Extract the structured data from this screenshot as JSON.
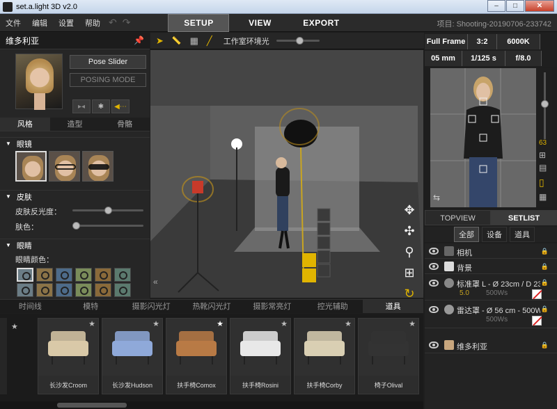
{
  "window": {
    "title": "set.a.light 3D v2.0",
    "min": "–",
    "max": "□",
    "close": "✕"
  },
  "menu": {
    "items": [
      "文件",
      "编辑",
      "设置",
      "帮助"
    ],
    "undo": "↶",
    "redo": "↷",
    "tabs": [
      "SETUP",
      "VIEW",
      "EXPORT"
    ],
    "active_tab": "SETUP",
    "project": "项目: Shooting-20190706-233742"
  },
  "left": {
    "model_name": "维多利亚",
    "pose_slider": "Pose Slider",
    "posing_mode": "POSING MODE",
    "subtabs": [
      "风格",
      "造型",
      "骨骼"
    ],
    "active_subtab": "风格",
    "glasses_label": "眼镜",
    "skin_label": "皮肤",
    "skin_reflect": "皮肤反光度：",
    "skin_color": "肤色：",
    "eyes_label": "眼睛",
    "eye_color": "眼睛颜色：",
    "eye_colors": [
      "#6b7d86",
      "#8b7347",
      "#4d6b8a",
      "#7a8c5a",
      "#8a6a3a",
      "#5b7a6e"
    ],
    "skin_reflect_value": 0.5,
    "skin_color_value": 0.0
  },
  "viewport": {
    "ambient_label": "工作室环境光",
    "nav": [
      "✥",
      "✣",
      "⚲",
      "⊞",
      "↻"
    ],
    "collapse": "«"
  },
  "bottom": {
    "categories": [
      "时间线",
      "模特",
      "摄影闪光灯",
      "热靴闪光灯",
      "摄影常亮灯",
      "控光辅助",
      "道具"
    ],
    "active_category": "道具",
    "items": [
      {
        "label": "长沙发Croom",
        "color": "#d9c9a8",
        "starred": false
      },
      {
        "label": "长沙发Hudson",
        "color": "#8fa9d9",
        "starred": false
      },
      {
        "label": "扶手椅Comox",
        "color": "#b87a45",
        "starred": true
      },
      {
        "label": "扶手椅Rosini",
        "color": "#e8e8e8",
        "starred": false
      },
      {
        "label": "扶手椅Corby",
        "color": "#d9cfb3",
        "starred": false
      },
      {
        "label": "椅子Olival",
        "color": "#333333",
        "starred": false
      }
    ],
    "star": "★"
  },
  "right": {
    "camera": {
      "format": "Full Frame",
      "ratio": "3:2",
      "wb": "6000K",
      "focal": "05 mm",
      "shutter": "1/125 s",
      "aperture": "f/8.0",
      "zoom_value": "63"
    },
    "tabs": [
      "TOPVIEW",
      "SETLIST"
    ],
    "active_tab": "SETLIST",
    "subtabs": [
      "全部",
      "设备",
      "道具"
    ],
    "active_subtab": "全部",
    "list": [
      {
        "name": "相机"
      },
      {
        "name": "背景"
      },
      {
        "name": "标准罩 L - Ø 23cm / D 23",
        "power": "5.0",
        "watt": "500Ws"
      },
      {
        "name": "雷达罩 - Ø 56 cm - 500W",
        "power": "",
        "watt": "500Ws"
      },
      {
        "name": "维多利亚"
      }
    ]
  }
}
